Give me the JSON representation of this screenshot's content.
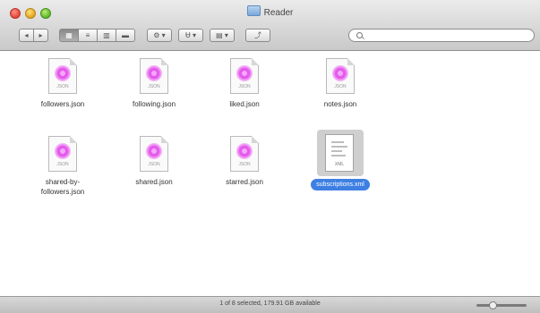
{
  "window": {
    "title": "Reader"
  },
  "toolbar": {
    "back_label": "◂",
    "forward_label": "▸",
    "view_icons_label": "▦",
    "view_list_label": "≡",
    "view_columns_label": "▥",
    "view_coverflow_label": "▬",
    "action_label": "⚙ ▾",
    "share_label": "Ʉ ▾",
    "arrange_label": "▤ ▾",
    "path_label": "⤴"
  },
  "search": {
    "placeholder": ""
  },
  "files": [
    {
      "name": "followers.json",
      "ext": "JSON",
      "kind": "json"
    },
    {
      "name": "following.json",
      "ext": "JSON",
      "kind": "json"
    },
    {
      "name": "liked.json",
      "ext": "JSON",
      "kind": "json"
    },
    {
      "name": "notes.json",
      "ext": "JSON",
      "kind": "json"
    },
    {
      "name": "shared-by-followers.json",
      "ext": "JSON",
      "kind": "json"
    },
    {
      "name": "shared.json",
      "ext": "JSON",
      "kind": "json"
    },
    {
      "name": "starred.json",
      "ext": "JSON",
      "kind": "json"
    },
    {
      "name": "subscriptions.xml",
      "ext": "XML",
      "kind": "xml",
      "selected": true
    }
  ],
  "status": {
    "text": "1 of 8 selected, 179.91 GB available"
  },
  "colors": {
    "selection": "#3e7fe3",
    "json_icon": "#e45bea"
  }
}
